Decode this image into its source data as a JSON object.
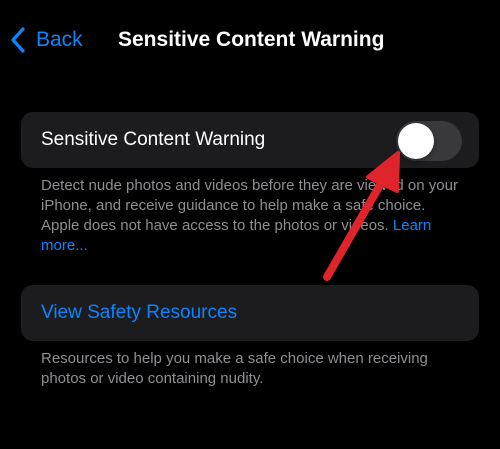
{
  "nav": {
    "back_label": "Back",
    "title": "Sensitive Content Warning"
  },
  "toggle": {
    "label": "Sensitive Content Warning",
    "state": "off"
  },
  "description": {
    "text": "Detect nude photos and videos before they are viewed on your iPhone, and receive guidance to help make a safe choice. Apple does not have access to the photos or videos.",
    "link_label": "Learn more..."
  },
  "safety": {
    "link_label": "View Safety Resources",
    "footnote": "Resources to help you make a safe choice when receiving photos or video containing nudity."
  },
  "icons": {
    "back": "chevron-left-icon",
    "annotation": "red-arrow-icon"
  },
  "colors": {
    "background": "#000000",
    "card": "#1c1c1e",
    "accent": "#0a84ff",
    "secondary_text": "#8e8e93",
    "switch_off": "#39393d",
    "annotation_arrow": "#e0242b"
  }
}
